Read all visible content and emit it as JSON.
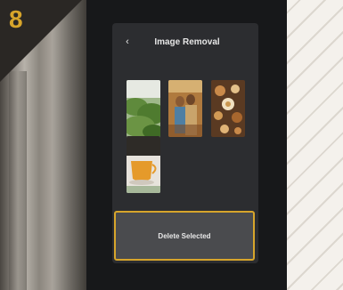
{
  "step": {
    "number": "8"
  },
  "header": {
    "back_icon": "‹",
    "title": "Image Removal"
  },
  "gallery": {
    "images": [
      {
        "name": "tea-plantation",
        "selected": false
      },
      {
        "name": "women-market",
        "selected": false
      },
      {
        "name": "desserts-tray",
        "selected": false
      },
      {
        "name": "tea-cup",
        "selected": false
      }
    ]
  },
  "actions": {
    "delete_label": "Delete Selected"
  },
  "colors": {
    "accent": "#d7a52b",
    "screen_bg": "#2c2d30",
    "button_bg": "#4a4b4e"
  }
}
